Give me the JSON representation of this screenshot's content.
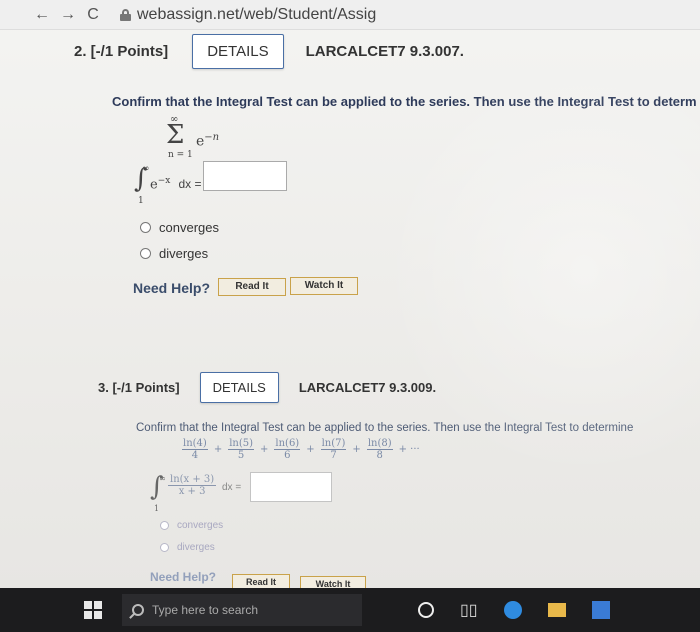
{
  "browser": {
    "back_icon": "←",
    "forward_icon": "→",
    "reload_icon": "C",
    "url": "webassign.net/web/Student/Assig"
  },
  "q2": {
    "number": "2. [-/1 Points]",
    "details": "DETAILS",
    "code": "LARCALCET7 9.3.007.",
    "instruction": "Confirm that the Integral Test can be applied to the series. Then use the Integral Test to determ",
    "sum_top": "∞",
    "sum_sigma": "Σ",
    "sum_term": "e",
    "sum_exp": "−n",
    "sum_bottom": "n = 1",
    "int_sym": "∫",
    "int_upper": "∞",
    "int_lower": "1",
    "integrand": "e",
    "integrand_exp": "−x",
    "int_tail": "dx =",
    "opt_converges": "converges",
    "opt_diverges": "diverges",
    "need_help": "Need Help?",
    "read_it": "Read It",
    "watch_it": "Watch It"
  },
  "q3": {
    "number": "3. [-/1 Points]",
    "details": "DETAILS",
    "code": "LARCALCET7 9.3.009.",
    "instruction": "Confirm that the Integral Test can be applied to the series. Then use the Integral Test to determine",
    "series": "ln(4)/4 + ln(5)/5 + ln(6)/6 + ln(7)/7 + ln(8)/8 + ···",
    "terms": [
      {
        "num": "ln(4)",
        "den": "4"
      },
      {
        "num": "ln(5)",
        "den": "5"
      },
      {
        "num": "ln(6)",
        "den": "6"
      },
      {
        "num": "ln(7)",
        "den": "7"
      },
      {
        "num": "ln(8)",
        "den": "8"
      }
    ],
    "plus": "+",
    "dots": "+ ···",
    "int_sym": "∫",
    "int_upper": "∞",
    "int_lower": "1",
    "int_num": "ln(x + 3)",
    "int_den": "x + 3",
    "int_tail": "dx =",
    "opt_converges": "converges",
    "opt_diverges": "diverges",
    "need_help": "Need Help?",
    "read_it": "Read It",
    "watch_it": "Watch It"
  },
  "taskbar": {
    "search_placeholder": "Type here to search"
  }
}
